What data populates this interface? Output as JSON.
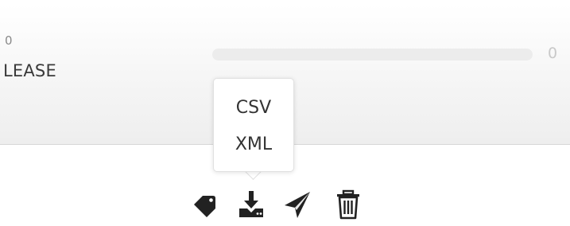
{
  "card": {
    "count": "0",
    "label": "LEASE",
    "progress_value": "0",
    "progress_fraction": 0
  },
  "export_menu": {
    "items": [
      "CSV",
      "XML"
    ]
  },
  "toolbar": {
    "icons": [
      "tag-icon",
      "download-icon",
      "send-icon",
      "trash-icon"
    ]
  }
}
